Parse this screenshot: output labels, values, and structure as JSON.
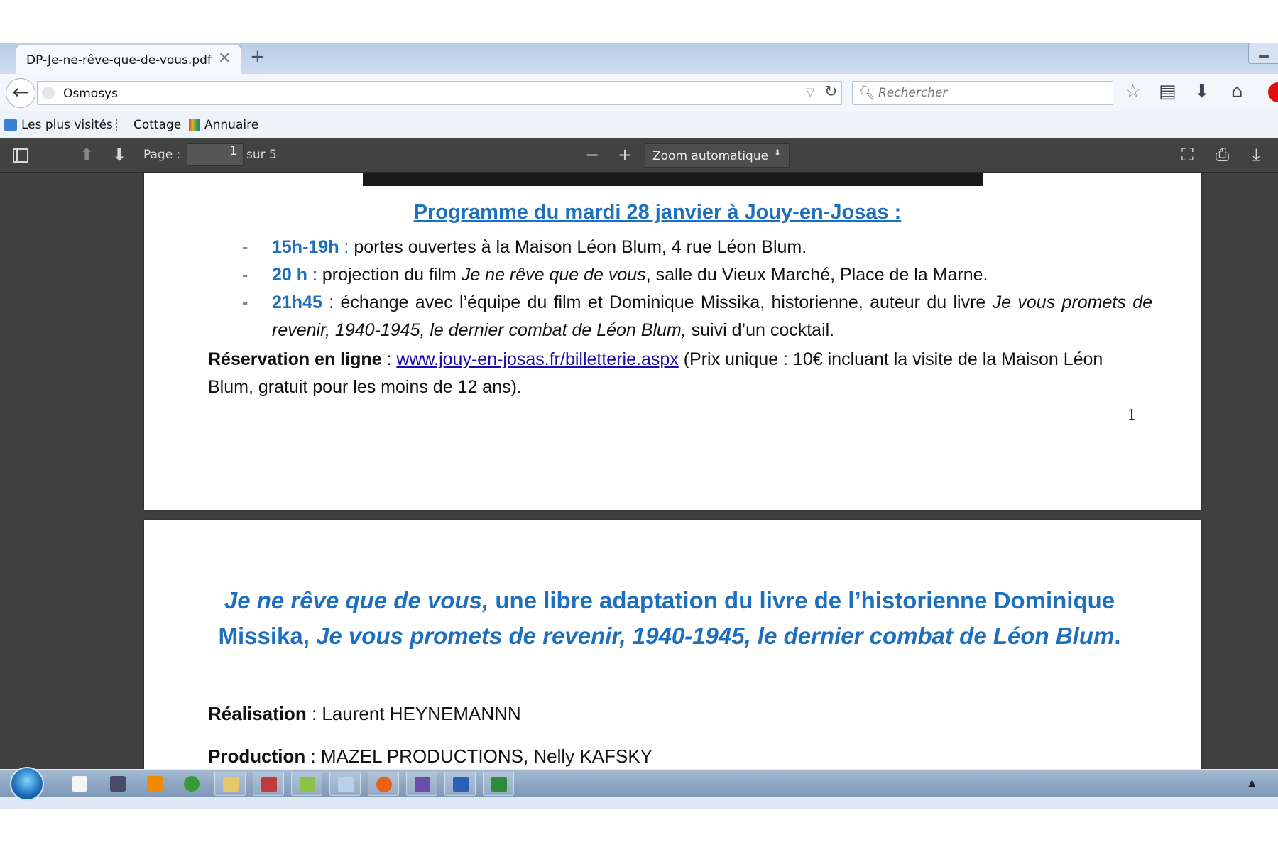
{
  "browser": {
    "tab_title": "DP-Je-ne-rêve-que-de-vous.pdf",
    "url": "Osmosys",
    "search_placeholder": "Rechercher",
    "bookmarks": [
      "Les plus visités",
      "Cottage",
      "Annuaire"
    ]
  },
  "pdf_toolbar": {
    "page_label": "Page :",
    "current_page": "1",
    "total_pages": "sur 5",
    "zoom": "Zoom automatique"
  },
  "page1": {
    "title": "Programme du mardi 28 janvier à Jouy-en-Josas :",
    "items": [
      {
        "time": "15h-19h",
        "sep": " : ",
        "text": "portes ouvertes à la Maison Léon Blum, 4 rue Léon Blum."
      },
      {
        "time": "20 h",
        "sep": " : ",
        "text_pre": "projection du film ",
        "film": "Je ne rêve que de vous",
        "text_post": ", salle du Vieux Marché, Place de la Marne."
      },
      {
        "time": "21h45",
        "sep": " : ",
        "text_pre": "échange avec l’équipe du film et Dominique Missika, historienne, auteur du livre ",
        "book": "Je vous promets de revenir, 1940-1945, le dernier combat de Léon Blum,",
        "text_post": " suivi d’un cocktail."
      }
    ],
    "reservation_label": "Réservation en ligne",
    "reservation_sep": " : ",
    "reservation_link": "www.jouy-en-josas.fr/billetterie.aspx",
    "reservation_text": " (Prix unique : 10€ incluant la visite de la Maison Léon Blum, gratuit pour les moins de 12 ans).",
    "page_number": "1"
  },
  "page2": {
    "title_film": "Je ne rêve que de vous,",
    "title_mid": " une libre adaptation du livre de l’historienne Dominique Missika, ",
    "title_book": "Je vous promets de revenir, 1940-1945, le dernier combat de Léon Blum",
    "title_end": ".",
    "realisation_label": "Réalisation",
    "realisation_value": " : Laurent HEYNEMANNN",
    "production_label": "Production",
    "production_value": " : MAZEL PRODUCTIONS, Nelly KAFSKY"
  },
  "colors": {
    "accent_blue": "#1f6fbf",
    "pdf_toolbar": "#424242",
    "viewer_bg": "#404040"
  },
  "taskbar_apps": [
    "blank-document-icon",
    "media-app-icon",
    "vlc-icon",
    "triangle-app-icon",
    "file-explorer-icon",
    "paint-icon",
    "spreadsheet-tool-icon",
    "paper-icon",
    "firefox-icon",
    "shield-app-icon",
    "writer-icon",
    "calc-icon"
  ]
}
